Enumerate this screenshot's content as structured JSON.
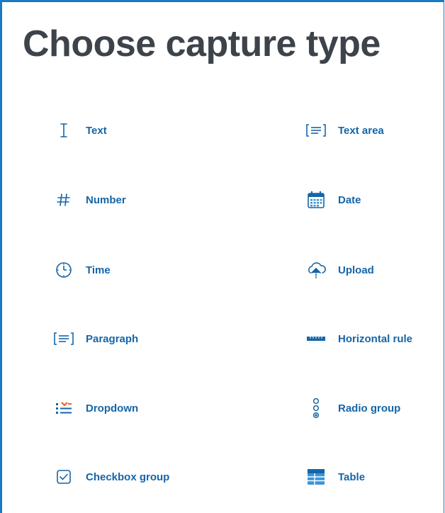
{
  "page": {
    "title": "Choose capture type"
  },
  "options": [
    {
      "label": "Text",
      "icon": "text-cursor-icon"
    },
    {
      "label": "Text area",
      "icon": "text-area-icon"
    },
    {
      "label": "Number",
      "icon": "hash-icon"
    },
    {
      "label": "Date",
      "icon": "calendar-icon"
    },
    {
      "label": "Time",
      "icon": "clock-icon"
    },
    {
      "label": "Upload",
      "icon": "cloud-upload-icon"
    },
    {
      "label": "Paragraph",
      "icon": "paragraph-icon"
    },
    {
      "label": "Horizontal rule",
      "icon": "ruler-icon"
    },
    {
      "label": "Dropdown",
      "icon": "dropdown-list-icon"
    },
    {
      "label": "Radio group",
      "icon": "radio-group-icon"
    },
    {
      "label": "Checkbox group",
      "icon": "checkbox-icon"
    },
    {
      "label": "Table",
      "icon": "table-icon"
    }
  ],
  "colors": {
    "accent": "#1a7ac4",
    "label": "#1565a8",
    "title": "#3d434a",
    "orange": "#e8641e"
  }
}
